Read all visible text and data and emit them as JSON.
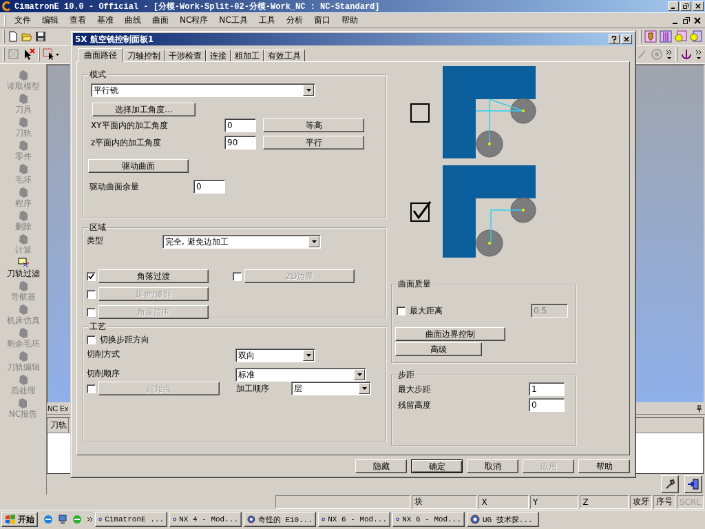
{
  "app": {
    "title": "CimatronE 10.0 - Official - [分模-Work-Split-02-分模-Work_NC : NC-Standard]"
  },
  "menu": [
    "文件",
    "编辑",
    "查看",
    "基准",
    "曲线",
    "曲面",
    "NC程序",
    "NC工具",
    "工具",
    "分析",
    "窗口",
    "帮助"
  ],
  "sidebar": [
    {
      "label": "读取模型",
      "disabled": true
    },
    {
      "label": "刀具",
      "disabled": true
    },
    {
      "label": "刀轨",
      "disabled": true
    },
    {
      "label": "零件",
      "disabled": true
    },
    {
      "label": "毛坯",
      "disabled": true
    },
    {
      "label": "程序",
      "disabled": true
    },
    {
      "label": "删除",
      "disabled": true
    },
    {
      "label": "计算",
      "disabled": true
    },
    {
      "label": "刀轨过滤",
      "disabled": false
    },
    {
      "label": "导航器",
      "disabled": true
    },
    {
      "label": "机床仿真",
      "disabled": true
    },
    {
      "label": "剩余毛坯",
      "disabled": true
    },
    {
      "label": "刀轨编辑",
      "disabled": true
    },
    {
      "label": "后处理",
      "disabled": true
    },
    {
      "label": "NC报告",
      "disabled": true
    }
  ],
  "nc_panel": {
    "title": "NC Ex",
    "column_1": "刀轨"
  },
  "status_bar": {
    "fields": [
      "块",
      "X",
      "Y",
      "Z"
    ],
    "indicators": [
      {
        "label": "攻牙",
        "active": true
      },
      {
        "label": "序号",
        "active": true
      },
      {
        "label": "SCRL",
        "active": false
      }
    ]
  },
  "taskbar": {
    "start": "开始",
    "tasks": [
      {
        "label": "CimatronE ...",
        "selected": false
      },
      {
        "label": "NX 4 - Mod...",
        "selected": false
      },
      {
        "label": "奇怪的 E10...",
        "selected": false
      },
      {
        "label": "NX 6 - Mod...",
        "selected": false
      },
      {
        "label": "NX 6 - Mod...",
        "selected": false
      },
      {
        "label": "UG 技术探...",
        "selected": false
      }
    ]
  },
  "dialog": {
    "title": "5X 航空铣控制面板1",
    "tabs": [
      {
        "label": "曲面路径",
        "selected": true
      },
      {
        "label": "刀轴控制",
        "selected": false
      },
      {
        "label": "干涉检查",
        "selected": false
      },
      {
        "label": "连接",
        "selected": false
      },
      {
        "label": "粗加工",
        "selected": false
      },
      {
        "label": "有效工具",
        "selected": false
      }
    ],
    "mode_group": {
      "title": "模式",
      "pattern": "平行铣",
      "angle_button": "选择加工角度...",
      "xy_angle": {
        "label": "XY平面内的加工角度",
        "value": "0",
        "button": "等高"
      },
      "z_angle": {
        "label": "z平面内的加工角度",
        "value": "90",
        "button": "平行"
      },
      "drive_button": "驱动曲面",
      "drive_stock": {
        "label": "驱动曲面余量",
        "value": "0"
      }
    },
    "area_group": {
      "title": "区域",
      "type_label": "类型",
      "type_value": "完全, 避免边加工",
      "options": [
        {
          "label": "角落过渡",
          "checked": true,
          "disabled": false
        },
        {
          "label": "2D边界",
          "checked": false,
          "disabled": true
        },
        {
          "label": "延伸/修剪",
          "checked": false,
          "disabled": true
        },
        {
          "label": "角度范围",
          "checked": false,
          "disabled": true
        }
      ]
    },
    "process_group": {
      "title": "工艺",
      "switch_stepover": {
        "label": "切换步距方向",
        "checked": false
      },
      "cut_style": {
        "label": "切削方式",
        "value": "双向"
      },
      "cut_order": {
        "label": "切削顺序",
        "value": "标准"
      },
      "start_point": {
        "label": "起始点",
        "checked": false,
        "disabled": true
      },
      "machining_order": {
        "label": "加工顺序",
        "value": "层"
      }
    },
    "corner_diagrams": [
      {
        "kind": "diagonal",
        "checked": false
      },
      {
        "kind": "square",
        "checked": true
      }
    ],
    "surface_quality": {
      "title": "曲面质量",
      "max_distance": {
        "label": "最大距离",
        "checked": false,
        "value": "0.5",
        "disabled": true
      },
      "boundary_button": "曲面边界控制",
      "advanced_button": "高级"
    },
    "stepover": {
      "title": "步距",
      "max_step": {
        "label": "最大步距",
        "value": "1"
      },
      "scallop": {
        "label": "残留高度",
        "value": "0"
      }
    },
    "buttons": [
      {
        "label": "隐藏",
        "default": false,
        "disabled": false
      },
      {
        "label": "确定",
        "default": true,
        "disabled": false
      },
      {
        "label": "取消",
        "default": false,
        "disabled": false
      },
      {
        "label": "应用",
        "default": false,
        "disabled": true
      },
      {
        "label": "帮助",
        "default": false,
        "disabled": false
      }
    ]
  }
}
